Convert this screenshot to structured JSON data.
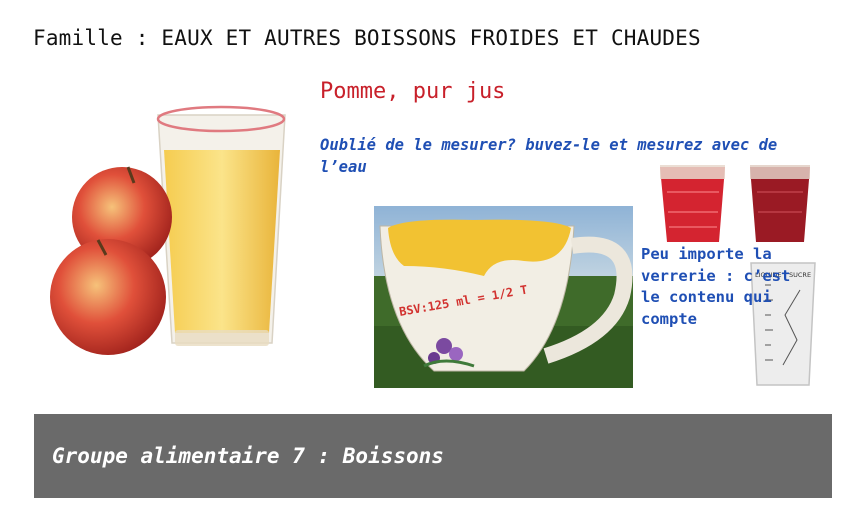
{
  "header": {
    "family": "Famille : EAUX ET AUTRES BOISSONS FROIDES ET CHAUDES"
  },
  "product": {
    "name": "Pomme, pur jus"
  },
  "note": {
    "text": "Oublié de le mesurer? buvez-le et mesurez avec de l’eau"
  },
  "glassware_note": {
    "text": "Peu importe la verrerie : c’est le contenu qui compte"
  },
  "cup": {
    "label": "BSV:125 ml = 1/2 T"
  },
  "measuring_cup": {
    "labels": [
      "LIQUIDE",
      "SUCRE"
    ]
  },
  "footer": {
    "group": "Groupe alimentaire 7 : Boissons"
  },
  "colors": {
    "title": "#c8202a",
    "note": "#1f4fb4",
    "footer_bg": "#6a6a6a",
    "juice": "#f2c232"
  }
}
